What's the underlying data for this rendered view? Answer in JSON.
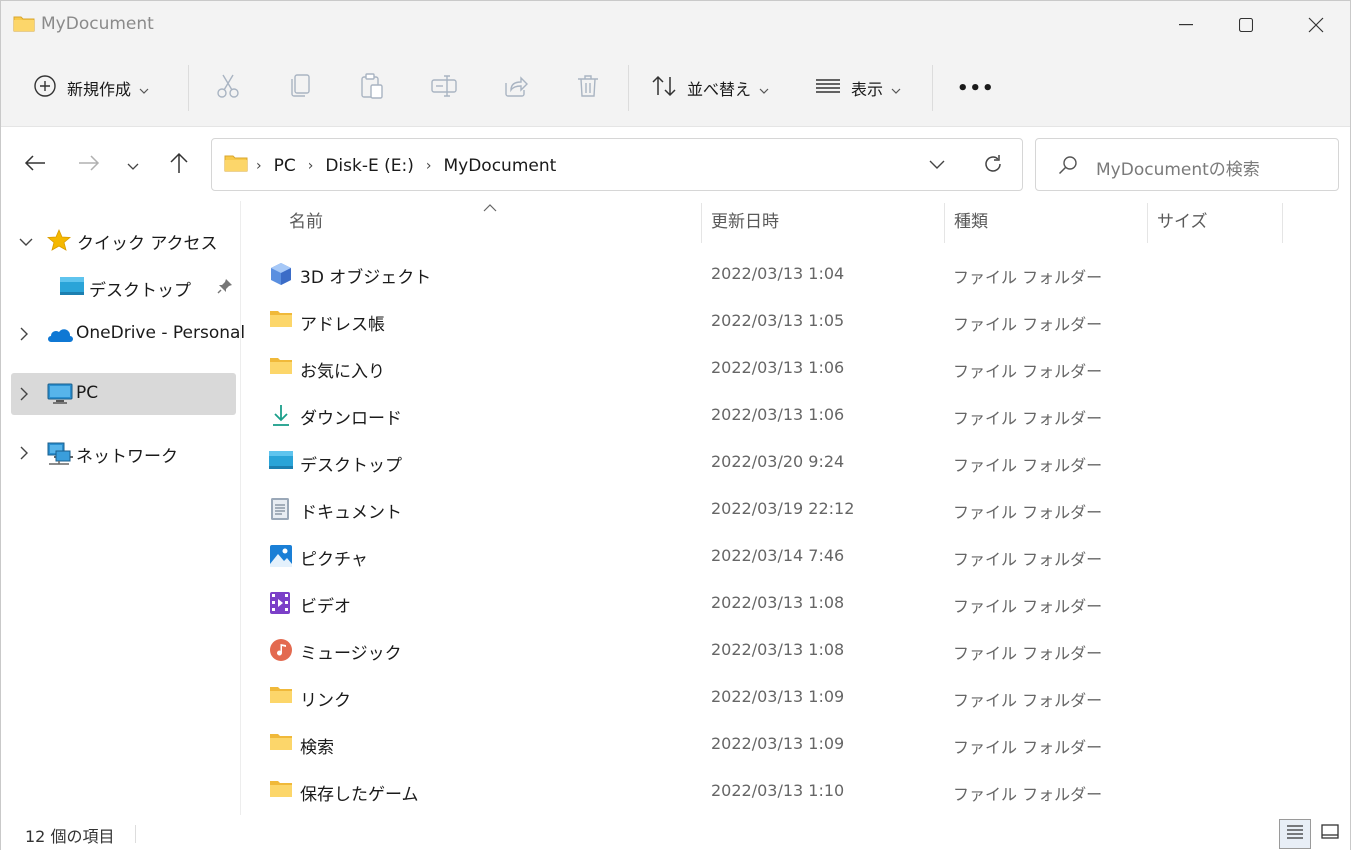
{
  "window": {
    "title": "MyDocument"
  },
  "toolbar": {
    "new_label": "新規作成",
    "sort_label": "並べ替え",
    "view_label": "表示",
    "more_label": "•••"
  },
  "address": {
    "crumbs": [
      "PC",
      "Disk-E (E:)",
      "MyDocument"
    ]
  },
  "search": {
    "placeholder": "MyDocumentの検索"
  },
  "sidebar": {
    "items": [
      {
        "label": "クイック アクセス",
        "icon": "star-icon"
      },
      {
        "label": "デスクトップ",
        "icon": "desktop-icon"
      },
      {
        "label": "OneDrive - Personal",
        "icon": "onedrive-icon"
      },
      {
        "label": "PC",
        "icon": "pc-icon"
      },
      {
        "label": "ネットワーク",
        "icon": "network-icon"
      }
    ]
  },
  "columns": {
    "name": "名前",
    "modified": "更新日時",
    "type": "種類",
    "size": "サイズ"
  },
  "files": [
    {
      "name": "3D オブジェクト",
      "date": "2022/03/13 1:04",
      "type": "ファイル フォルダー",
      "icon": "3d-objects-icon"
    },
    {
      "name": "アドレス帳",
      "date": "2022/03/13 1:05",
      "type": "ファイル フォルダー",
      "icon": "folder-icon"
    },
    {
      "name": "お気に入り",
      "date": "2022/03/13 1:06",
      "type": "ファイル フォルダー",
      "icon": "folder-icon"
    },
    {
      "name": "ダウンロード",
      "date": "2022/03/13 1:06",
      "type": "ファイル フォルダー",
      "icon": "download-icon"
    },
    {
      "name": "デスクトップ",
      "date": "2022/03/20 9:24",
      "type": "ファイル フォルダー",
      "icon": "desktop-icon"
    },
    {
      "name": "ドキュメント",
      "date": "2022/03/19 22:12",
      "type": "ファイル フォルダー",
      "icon": "document-icon"
    },
    {
      "name": "ピクチャ",
      "date": "2022/03/14 7:46",
      "type": "ファイル フォルダー",
      "icon": "pictures-icon"
    },
    {
      "name": "ビデオ",
      "date": "2022/03/13 1:08",
      "type": "ファイル フォルダー",
      "icon": "video-icon"
    },
    {
      "name": "ミュージック",
      "date": "2022/03/13 1:08",
      "type": "ファイル フォルダー",
      "icon": "music-icon"
    },
    {
      "name": "リンク",
      "date": "2022/03/13 1:09",
      "type": "ファイル フォルダー",
      "icon": "folder-icon"
    },
    {
      "name": "検索",
      "date": "2022/03/13 1:09",
      "type": "ファイル フォルダー",
      "icon": "folder-icon"
    },
    {
      "name": "保存したゲーム",
      "date": "2022/03/13 1:10",
      "type": "ファイル フォルダー",
      "icon": "folder-icon"
    }
  ],
  "status": {
    "item_count": "12 個の項目"
  },
  "colors": {
    "folder": "#f8c94a",
    "selected": "#d9d9d9",
    "accent": "#0067c0"
  }
}
